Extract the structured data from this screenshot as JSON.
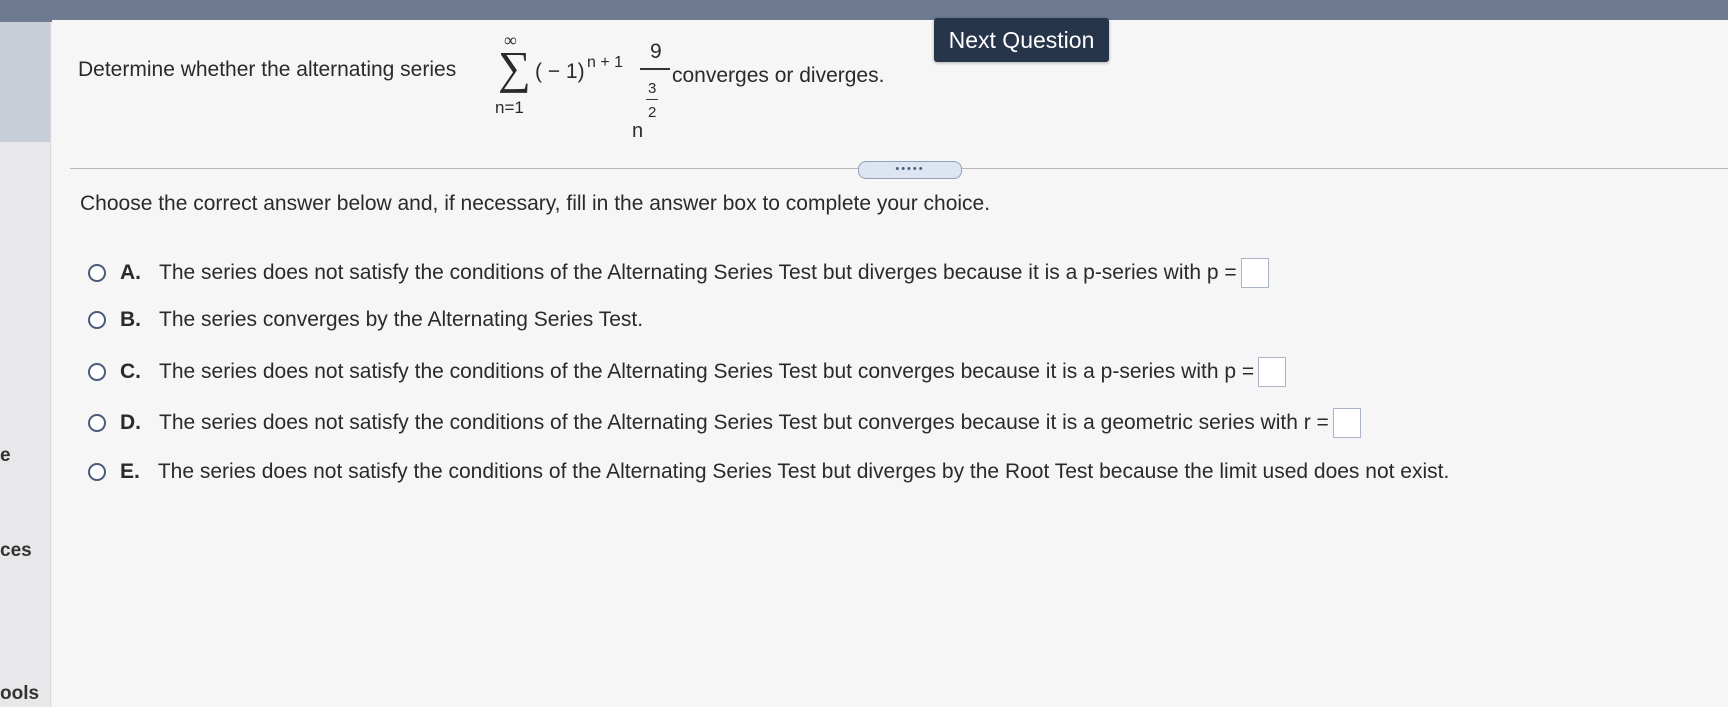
{
  "sidebar": {
    "labels": [
      "e",
      "ces",
      "ools"
    ]
  },
  "header": {
    "next_question_label": "Next Question"
  },
  "question": {
    "prefix": "Determine whether the alternating series",
    "sigma": "∑",
    "upper": "∞",
    "lower": "n=1",
    "base": "( − 1)",
    "exponent": "n + 1",
    "numerator": "9",
    "den_base": "n",
    "den_exp_num": "3",
    "den_exp_den": "2",
    "suffix": "converges or diverges."
  },
  "expand_button": {
    "label": "•••••"
  },
  "instruction": "Choose the correct answer below and, if necessary, fill in the answer box to complete your choice.",
  "options": [
    {
      "letter": "A.",
      "text": "The series does not satisfy the conditions of the Alternating Series Test but diverges because it is a p-series with p =",
      "has_box": true
    },
    {
      "letter": "B.",
      "text": "The series converges by the Alternating Series Test.",
      "has_box": false
    },
    {
      "letter": "C.",
      "text": "The series does not satisfy the conditions of the Alternating Series Test but converges because it is a p-series with p =",
      "has_box": true
    },
    {
      "letter": "D.",
      "text": "The series does not satisfy the conditions of the Alternating Series Test but converges because it is a geometric series with r =",
      "has_box": true
    },
    {
      "letter": "E.",
      "text": "The series does not satisfy the conditions of the Alternating Series Test but diverges by the Root Test because the limit used does not exist.",
      "has_box": false
    }
  ]
}
